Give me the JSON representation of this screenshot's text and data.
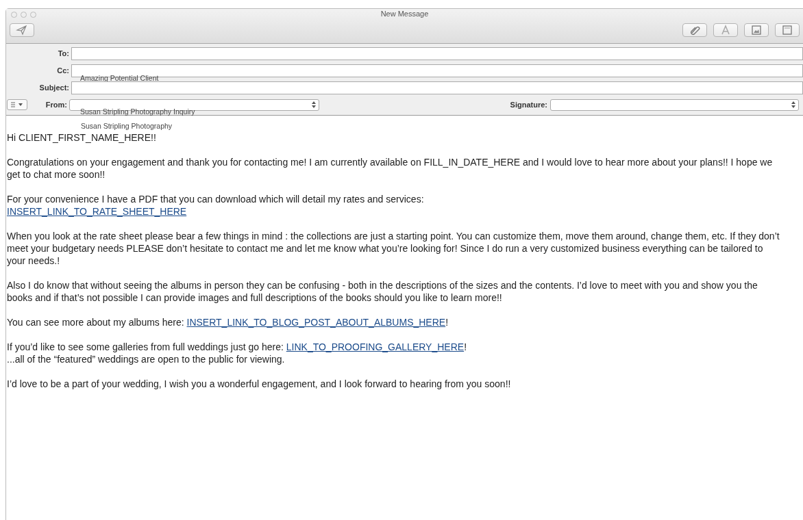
{
  "window": {
    "title": "New Message"
  },
  "toolbar": {
    "left": [
      {
        "kind": "send"
      }
    ],
    "right": [
      {
        "kind": "attach"
      },
      {
        "kind": "fonts"
      },
      {
        "kind": "photo"
      },
      {
        "kind": "template"
      }
    ]
  },
  "fields": [
    {
      "label": "To:"
    },
    {
      "label": "Cc:",
      "overlay": "Amazing Potential Client"
    },
    {
      "label": "Subject:"
    }
  ],
  "from": {
    "label": "From:",
    "overlay": "Susan Stripling Photography Inquiry",
    "signature_label": "Signature:"
  },
  "body": {
    "note": "Susan Stripling Photography",
    "paragraphs": [
      {
        "lines": [
          [
            {
              "kind": "text",
              "text": "Hi CLIENT_FIRST_NAME_HERE!!"
            }
          ]
        ]
      },
      {
        "lines": [
          [
            {
              "kind": "text",
              "text": "Congratulations on your engagement and thank you for contacting me! I am currently available on FILL_IN_DATE_HERE and I would love to hear more about your plans!! I hope we get to chat more soon!!"
            }
          ]
        ]
      },
      {
        "lines": [
          [
            {
              "kind": "text",
              "text": "For your convenience I have a PDF that you can download which will detail my rates and services:"
            }
          ],
          [
            {
              "kind": "link",
              "text": "INSERT_LINK_TO_RATE_SHEET_HERE"
            }
          ]
        ]
      },
      {
        "lines": [
          [
            {
              "kind": "text",
              "text": "When you look at the rate sheet please bear a few things in mind : the collections are just a starting point. You can customize them, move them around, change them, etc. If they don’t meet your budgetary needs PLEASE don’t hesitate to contact me and let me know what you’re looking for! Since I do run a very customized business everything can be tailored to your needs.!"
            }
          ]
        ]
      },
      {
        "lines": [
          [
            {
              "kind": "text",
              "text": "Also I do know that without seeing the albums in person they can be confusing - both in the descriptions of the sizes and the contents. I’d love to meet with you and show you the books and if that’s not possible I can provide images and full descriptions of the books should you like to learn more!!"
            }
          ]
        ]
      },
      {
        "lines": [
          [
            {
              "kind": "text",
              "text": "You can see more about my albums here:  "
            },
            {
              "kind": "link",
              "text": "INSERT_LINK_TO_BLOG_POST_ABOUT_ALBUMS_HERE"
            },
            {
              "kind": "text",
              "text": "!"
            }
          ]
        ]
      },
      {
        "lines": [
          [
            {
              "kind": "text",
              "text": "If you’d like to see some galleries from full weddings just go here: "
            },
            {
              "kind": "link",
              "text": "LINK_TO_PROOFING_GALLERY_HERE"
            },
            {
              "kind": "text",
              "text": "!"
            }
          ],
          [
            {
              "kind": "text",
              "text": "...all of the “featured” weddings are open to the public for viewing."
            }
          ]
        ]
      },
      {
        "lines": [
          [
            {
              "kind": "text",
              "text": "I’d love to be a part of your wedding, I wish you a wonderful engagement, and I look forward to hearing from you soon!!"
            }
          ]
        ]
      }
    ]
  }
}
